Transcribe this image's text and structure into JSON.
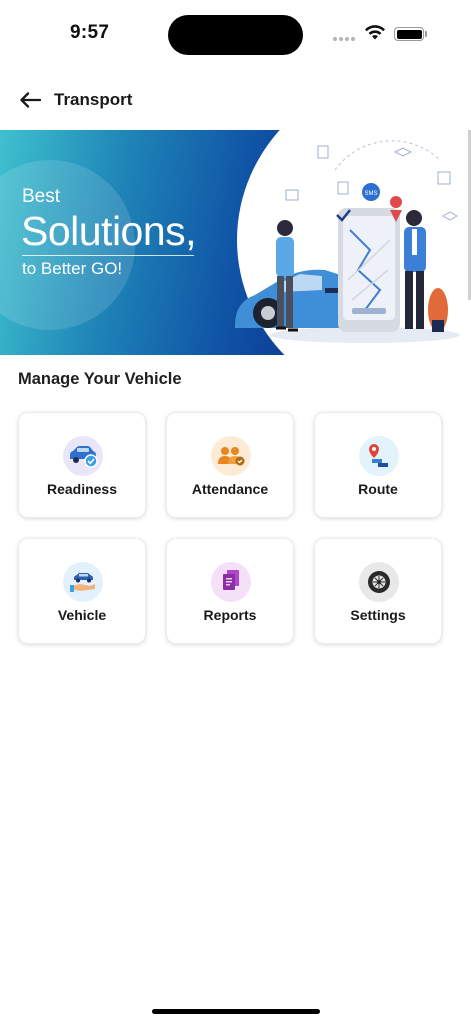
{
  "status_bar": {
    "time": "9:57"
  },
  "header": {
    "title": "Transport"
  },
  "banner": {
    "line1": "Best",
    "line2": "Solutions,",
    "line3": "to Better GO!",
    "sms_badge": "SMS"
  },
  "section": {
    "title": "Manage Your Vehicle"
  },
  "tiles": [
    {
      "label": "Readiness",
      "icon": "car-check-icon",
      "bg": "#e9e6f7"
    },
    {
      "label": "Attendance",
      "icon": "people-icon",
      "bg": "#fdebd6"
    },
    {
      "label": "Route",
      "icon": "route-pin-icon",
      "bg": "#e3f3fb"
    },
    {
      "label": "Vehicle",
      "icon": "car-hand-icon",
      "bg": "#e2f1fb"
    },
    {
      "label": "Reports",
      "icon": "reports-icon",
      "bg": "#f4e0f7"
    },
    {
      "label": "Settings",
      "icon": "tire-icon",
      "bg": "#e8e8e8"
    }
  ]
}
